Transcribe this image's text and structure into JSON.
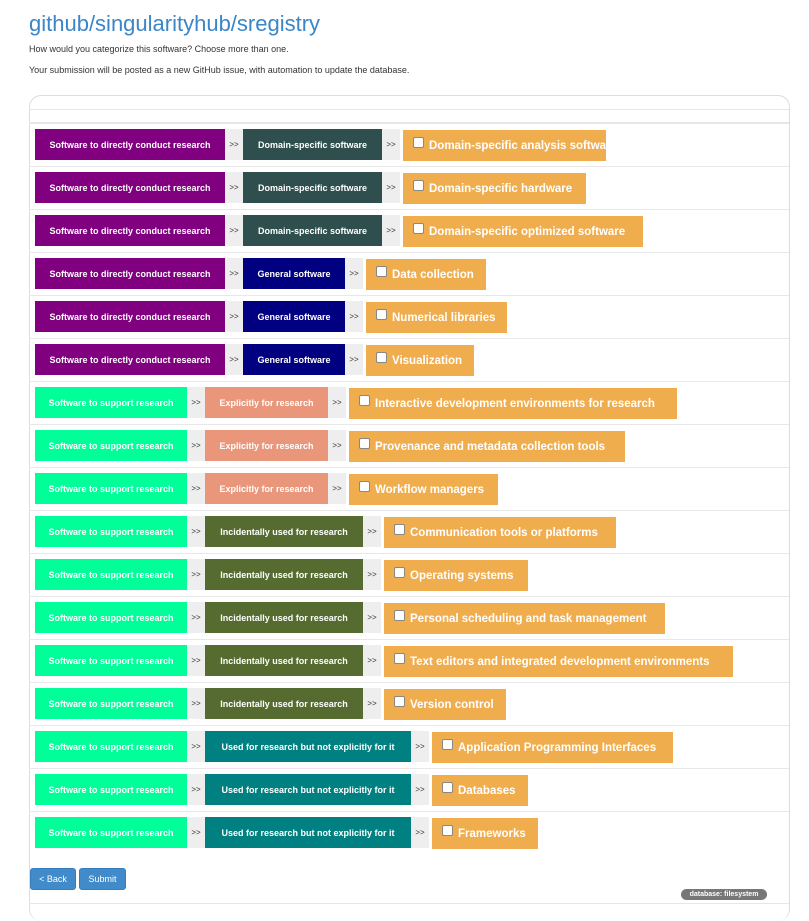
{
  "header": {
    "title": "github/singularityhub/sregistry",
    "intro1": "How would you categorize this software? Choose more than one.",
    "intro2": "Your submission will be posted as a new GitHub issue, with automation to update the database."
  },
  "separator": ">>",
  "colors": {
    "Software to directly conduct research": "#800080",
    "Software to support research": "#00ff99",
    "Domain-specific software": "#2f4f4f",
    "General software": "#000080",
    "Explicitly for research": "#e9967a",
    "Incidentally used for research": "#556b2f",
    "Used for research but not explicitly for it": "#008080",
    "option": "#f0ad4e"
  },
  "rows": [
    {
      "level1": "Software to directly conduct research",
      "level2": "Domain-specific software",
      "option": "Domain-specific analysis software"
    },
    {
      "level1": "Software to directly conduct research",
      "level2": "Domain-specific software",
      "option": "Domain-specific hardware"
    },
    {
      "level1": "Software to directly conduct research",
      "level2": "Domain-specific software",
      "option": "Domain-specific optimized software"
    },
    {
      "level1": "Software to directly conduct research",
      "level2": "General software",
      "option": "Data collection"
    },
    {
      "level1": "Software to directly conduct research",
      "level2": "General software",
      "option": "Numerical libraries"
    },
    {
      "level1": "Software to directly conduct research",
      "level2": "General software",
      "option": "Visualization"
    },
    {
      "level1": "Software to support research",
      "level2": "Explicitly for research",
      "option": "Interactive development environments for research"
    },
    {
      "level1": "Software to support research",
      "level2": "Explicitly for research",
      "option": "Provenance and metadata collection tools"
    },
    {
      "level1": "Software to support research",
      "level2": "Explicitly for research",
      "option": "Workflow managers"
    },
    {
      "level1": "Software to support research",
      "level2": "Incidentally used for research",
      "option": "Communication tools or platforms"
    },
    {
      "level1": "Software to support research",
      "level2": "Incidentally used for research",
      "option": "Operating systems"
    },
    {
      "level1": "Software to support research",
      "level2": "Incidentally used for research",
      "option": "Personal scheduling and task management"
    },
    {
      "level1": "Software to support research",
      "level2": "Incidentally used for research",
      "option": "Text editors and integrated development environments"
    },
    {
      "level1": "Software to support research",
      "level2": "Incidentally used for research",
      "option": "Version control"
    },
    {
      "level1": "Software to support research",
      "level2": "Used for research but not explicitly for it",
      "option": "Application Programming Interfaces"
    },
    {
      "level1": "Software to support research",
      "level2": "Used for research but not explicitly for it",
      "option": "Databases"
    },
    {
      "level1": "Software to support research",
      "level2": "Used for research but not explicitly for it",
      "option": "Frameworks"
    }
  ],
  "buttons": {
    "back": "< Back",
    "submit": "Submit"
  },
  "badge": "database: filesystem"
}
